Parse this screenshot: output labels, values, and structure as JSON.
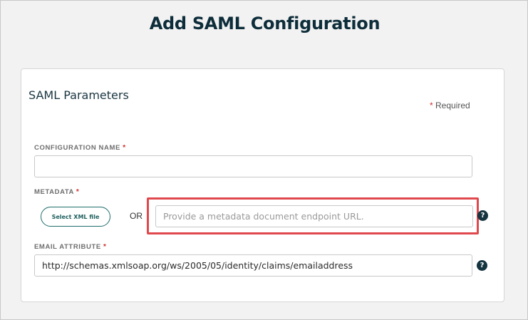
{
  "header": {
    "title": "Add SAML Configuration"
  },
  "card": {
    "title": "SAML Parameters",
    "required_note": "Required",
    "required_marker": "*"
  },
  "fields": {
    "configuration_name": {
      "label": "CONFIGURATION NAME",
      "value": ""
    },
    "metadata": {
      "label": "METADATA",
      "select_button": "Select XML file",
      "or_text": "OR",
      "placeholder": "Provide a metadata document endpoint URL.",
      "value": ""
    },
    "email_attribute": {
      "label": "EMAIL ATTRIBUTE",
      "value": "http://schemas.xmlsoap.org/ws/2005/05/identity/claims/emailaddress"
    }
  },
  "icons": {
    "help": "?"
  },
  "colors": {
    "title": "#0d2d3a",
    "required_star": "#d12f2f",
    "highlight_box": "#e0484d",
    "button_border": "#1f6b6b",
    "help_icon_bg": "#143440"
  }
}
